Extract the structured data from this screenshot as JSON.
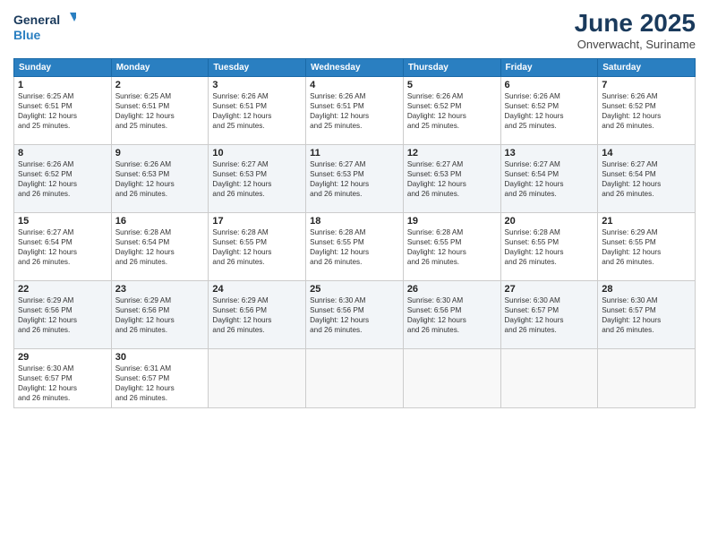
{
  "logo": {
    "line1": "General",
    "line2": "Blue"
  },
  "title": "June 2025",
  "subtitle": "Onverwacht, Suriname",
  "days_header": [
    "Sunday",
    "Monday",
    "Tuesday",
    "Wednesday",
    "Thursday",
    "Friday",
    "Saturday"
  ],
  "weeks": [
    [
      {
        "day": "1",
        "info": "Sunrise: 6:25 AM\nSunset: 6:51 PM\nDaylight: 12 hours\nand 25 minutes."
      },
      {
        "day": "2",
        "info": "Sunrise: 6:25 AM\nSunset: 6:51 PM\nDaylight: 12 hours\nand 25 minutes."
      },
      {
        "day": "3",
        "info": "Sunrise: 6:26 AM\nSunset: 6:51 PM\nDaylight: 12 hours\nand 25 minutes."
      },
      {
        "day": "4",
        "info": "Sunrise: 6:26 AM\nSunset: 6:51 PM\nDaylight: 12 hours\nand 25 minutes."
      },
      {
        "day": "5",
        "info": "Sunrise: 6:26 AM\nSunset: 6:52 PM\nDaylight: 12 hours\nand 25 minutes."
      },
      {
        "day": "6",
        "info": "Sunrise: 6:26 AM\nSunset: 6:52 PM\nDaylight: 12 hours\nand 25 minutes."
      },
      {
        "day": "7",
        "info": "Sunrise: 6:26 AM\nSunset: 6:52 PM\nDaylight: 12 hours\nand 26 minutes."
      }
    ],
    [
      {
        "day": "8",
        "info": "Sunrise: 6:26 AM\nSunset: 6:52 PM\nDaylight: 12 hours\nand 26 minutes."
      },
      {
        "day": "9",
        "info": "Sunrise: 6:26 AM\nSunset: 6:53 PM\nDaylight: 12 hours\nand 26 minutes."
      },
      {
        "day": "10",
        "info": "Sunrise: 6:27 AM\nSunset: 6:53 PM\nDaylight: 12 hours\nand 26 minutes."
      },
      {
        "day": "11",
        "info": "Sunrise: 6:27 AM\nSunset: 6:53 PM\nDaylight: 12 hours\nand 26 minutes."
      },
      {
        "day": "12",
        "info": "Sunrise: 6:27 AM\nSunset: 6:53 PM\nDaylight: 12 hours\nand 26 minutes."
      },
      {
        "day": "13",
        "info": "Sunrise: 6:27 AM\nSunset: 6:54 PM\nDaylight: 12 hours\nand 26 minutes."
      },
      {
        "day": "14",
        "info": "Sunrise: 6:27 AM\nSunset: 6:54 PM\nDaylight: 12 hours\nand 26 minutes."
      }
    ],
    [
      {
        "day": "15",
        "info": "Sunrise: 6:27 AM\nSunset: 6:54 PM\nDaylight: 12 hours\nand 26 minutes."
      },
      {
        "day": "16",
        "info": "Sunrise: 6:28 AM\nSunset: 6:54 PM\nDaylight: 12 hours\nand 26 minutes."
      },
      {
        "day": "17",
        "info": "Sunrise: 6:28 AM\nSunset: 6:55 PM\nDaylight: 12 hours\nand 26 minutes."
      },
      {
        "day": "18",
        "info": "Sunrise: 6:28 AM\nSunset: 6:55 PM\nDaylight: 12 hours\nand 26 minutes."
      },
      {
        "day": "19",
        "info": "Sunrise: 6:28 AM\nSunset: 6:55 PM\nDaylight: 12 hours\nand 26 minutes."
      },
      {
        "day": "20",
        "info": "Sunrise: 6:28 AM\nSunset: 6:55 PM\nDaylight: 12 hours\nand 26 minutes."
      },
      {
        "day": "21",
        "info": "Sunrise: 6:29 AM\nSunset: 6:55 PM\nDaylight: 12 hours\nand 26 minutes."
      }
    ],
    [
      {
        "day": "22",
        "info": "Sunrise: 6:29 AM\nSunset: 6:56 PM\nDaylight: 12 hours\nand 26 minutes."
      },
      {
        "day": "23",
        "info": "Sunrise: 6:29 AM\nSunset: 6:56 PM\nDaylight: 12 hours\nand 26 minutes."
      },
      {
        "day": "24",
        "info": "Sunrise: 6:29 AM\nSunset: 6:56 PM\nDaylight: 12 hours\nand 26 minutes."
      },
      {
        "day": "25",
        "info": "Sunrise: 6:30 AM\nSunset: 6:56 PM\nDaylight: 12 hours\nand 26 minutes."
      },
      {
        "day": "26",
        "info": "Sunrise: 6:30 AM\nSunset: 6:56 PM\nDaylight: 12 hours\nand 26 minutes."
      },
      {
        "day": "27",
        "info": "Sunrise: 6:30 AM\nSunset: 6:57 PM\nDaylight: 12 hours\nand 26 minutes."
      },
      {
        "day": "28",
        "info": "Sunrise: 6:30 AM\nSunset: 6:57 PM\nDaylight: 12 hours\nand 26 minutes."
      }
    ],
    [
      {
        "day": "29",
        "info": "Sunrise: 6:30 AM\nSunset: 6:57 PM\nDaylight: 12 hours\nand 26 minutes."
      },
      {
        "day": "30",
        "info": "Sunrise: 6:31 AM\nSunset: 6:57 PM\nDaylight: 12 hours\nand 26 minutes."
      },
      {
        "day": "",
        "info": ""
      },
      {
        "day": "",
        "info": ""
      },
      {
        "day": "",
        "info": ""
      },
      {
        "day": "",
        "info": ""
      },
      {
        "day": "",
        "info": ""
      }
    ]
  ]
}
